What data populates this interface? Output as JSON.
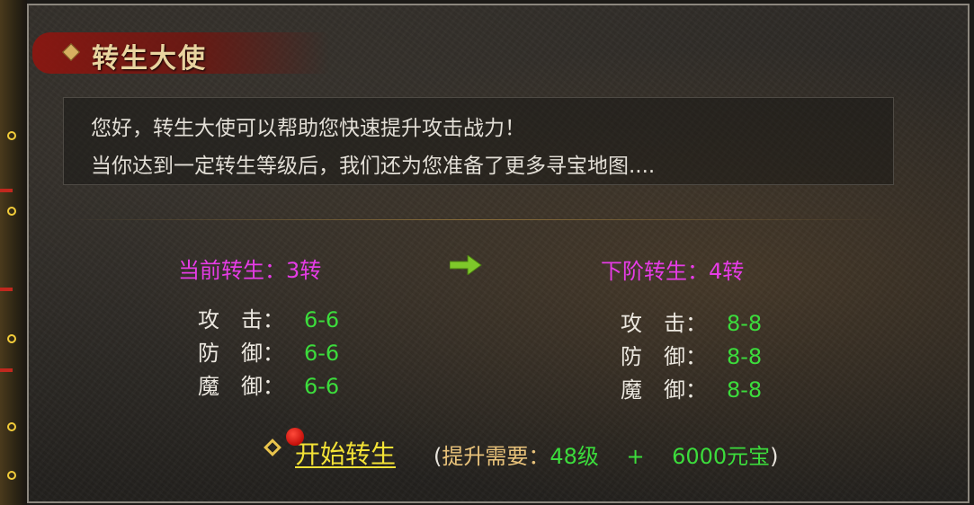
{
  "title": "转生大使",
  "intro": {
    "line1": "您好，转生大使可以帮助您快速提升攻击战力！",
    "line2": "当你达到一定转生等级后，我们还为您准备了更多寻宝地图...."
  },
  "current": {
    "label": "当前转生：",
    "value": "3转",
    "stats": [
      {
        "label": "攻　击：",
        "value": "6-6"
      },
      {
        "label": "防　御：",
        "value": "6-6"
      },
      {
        "label": "魔　御：",
        "value": "6-6"
      }
    ]
  },
  "next": {
    "label": "下阶转生：",
    "value": "4转",
    "stats": [
      {
        "label": "攻　击：",
        "value": "8-8"
      },
      {
        "label": "防　御：",
        "value": "8-8"
      },
      {
        "label": "魔　御：",
        "value": "8-8"
      }
    ]
  },
  "action": {
    "button_label": "开始转生",
    "req_open": "(",
    "req_label": "提升需要：",
    "req_level": "48级",
    "req_plus": "+",
    "req_gold": "6000元宝",
    "req_close": ")"
  },
  "colors": {
    "title": "#e9d4a0",
    "stage_title": "#e63ce6",
    "stat_value": "#3cdc3c",
    "button": "#f3e236",
    "arrow": "#7ec82a"
  },
  "icons": {
    "title": "diamond-bullet-icon",
    "arrow": "right-arrow-icon",
    "action": "diamond-outline-icon",
    "notify": "red-dot-icon"
  }
}
